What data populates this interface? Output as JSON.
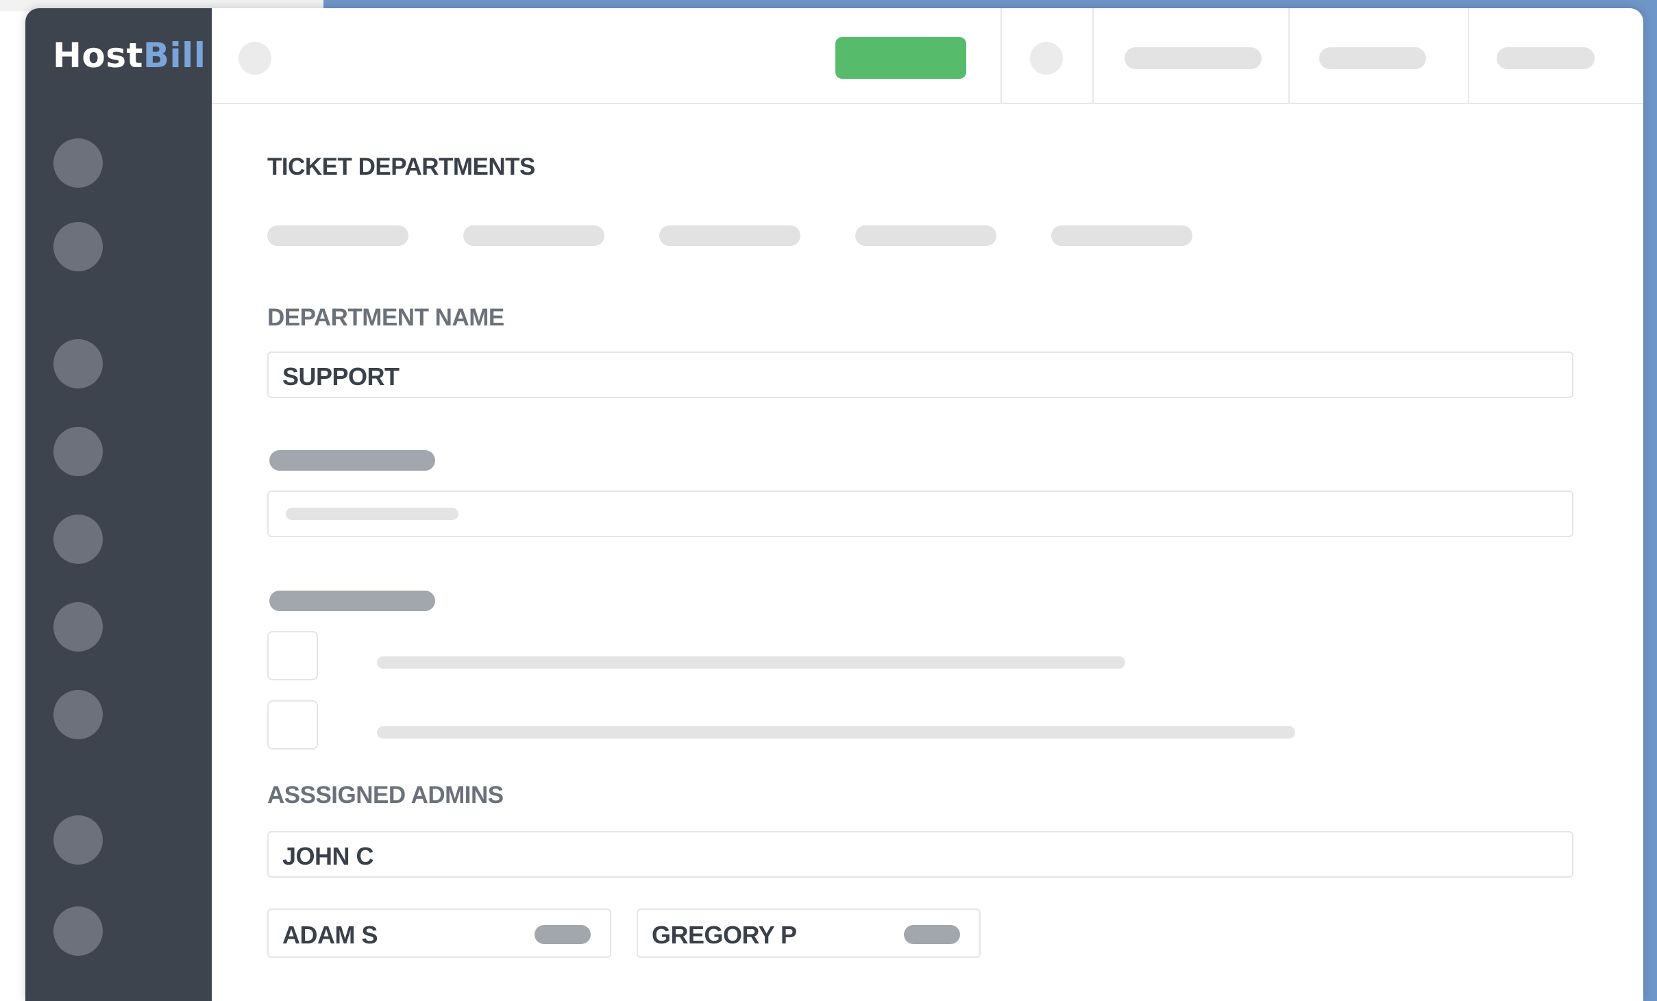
{
  "app": {
    "logo_part1": "Host",
    "logo_part2": "Bill"
  },
  "page": {
    "title": "TICKET DEPARTMENTS"
  },
  "form": {
    "department_name_label": "DEPARTMENT NAME",
    "department_name_value": "SUPPORT",
    "assigned_admins_label": "ASSSIGNED ADMINS",
    "assigned_admins_input": "JOHN C",
    "admin_chips": [
      "ADAM S",
      "GREGORY P"
    ]
  },
  "colors": {
    "sidebar": "#3e444e",
    "accent_blue": "#7aa4da",
    "primary_button": "#56bc6c",
    "background_frame": "#6f96c8"
  }
}
